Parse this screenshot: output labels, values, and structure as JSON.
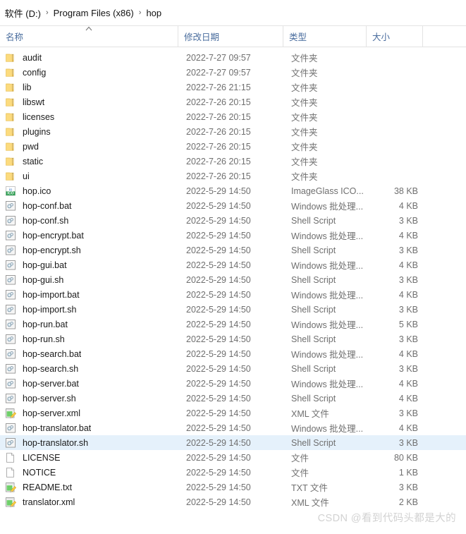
{
  "breadcrumb": {
    "lead_separator": "›",
    "separator": "›",
    "items": [
      {
        "label": "软件 (D:)"
      },
      {
        "label": "Program Files (x86)"
      },
      {
        "label": "hop"
      }
    ]
  },
  "columns": {
    "name": "名称",
    "date_modified": "修改日期",
    "type": "类型",
    "size": "大小",
    "sort_column": "名称",
    "sort_direction": "ascending",
    "sort_icon": "caret-up-icon"
  },
  "colors": {
    "selection": "#e5f1fb",
    "header_text": "#4a6d9e",
    "secondary_text": "#6f6f6f",
    "folder_icon": "#fcdb7e",
    "watermark": "#d2d2d2"
  },
  "files": [
    {
      "name": "audit",
      "date": "2022-7-27 09:57",
      "type": "文件夹",
      "size": "",
      "icon": "folder-icon",
      "selected": false
    },
    {
      "name": "config",
      "date": "2022-7-27 09:57",
      "type": "文件夹",
      "size": "",
      "icon": "folder-icon",
      "selected": false
    },
    {
      "name": "lib",
      "date": "2022-7-26 21:15",
      "type": "文件夹",
      "size": "",
      "icon": "folder-icon",
      "selected": false
    },
    {
      "name": "libswt",
      "date": "2022-7-26 20:15",
      "type": "文件夹",
      "size": "",
      "icon": "folder-icon",
      "selected": false
    },
    {
      "name": "licenses",
      "date": "2022-7-26 20:15",
      "type": "文件夹",
      "size": "",
      "icon": "folder-icon",
      "selected": false
    },
    {
      "name": "plugins",
      "date": "2022-7-26 20:15",
      "type": "文件夹",
      "size": "",
      "icon": "folder-icon",
      "selected": false
    },
    {
      "name": "pwd",
      "date": "2022-7-26 20:15",
      "type": "文件夹",
      "size": "",
      "icon": "folder-icon",
      "selected": false
    },
    {
      "name": "static",
      "date": "2022-7-26 20:15",
      "type": "文件夹",
      "size": "",
      "icon": "folder-icon",
      "selected": false
    },
    {
      "name": "ui",
      "date": "2022-7-26 20:15",
      "type": "文件夹",
      "size": "",
      "icon": "folder-icon",
      "selected": false
    },
    {
      "name": "hop.ico",
      "date": "2022-5-29 14:50",
      "type": "ImageGlass ICO...",
      "size": "38 KB",
      "icon": "ico-file-icon",
      "selected": false
    },
    {
      "name": "hop-conf.bat",
      "date": "2022-5-29 14:50",
      "type": "Windows 批处理...",
      "size": "4 KB",
      "icon": "script-file-icon",
      "selected": false
    },
    {
      "name": "hop-conf.sh",
      "date": "2022-5-29 14:50",
      "type": "Shell Script",
      "size": "3 KB",
      "icon": "script-file-icon",
      "selected": false
    },
    {
      "name": "hop-encrypt.bat",
      "date": "2022-5-29 14:50",
      "type": "Windows 批处理...",
      "size": "4 KB",
      "icon": "script-file-icon",
      "selected": false
    },
    {
      "name": "hop-encrypt.sh",
      "date": "2022-5-29 14:50",
      "type": "Shell Script",
      "size": "3 KB",
      "icon": "script-file-icon",
      "selected": false
    },
    {
      "name": "hop-gui.bat",
      "date": "2022-5-29 14:50",
      "type": "Windows 批处理...",
      "size": "4 KB",
      "icon": "script-file-icon",
      "selected": false
    },
    {
      "name": "hop-gui.sh",
      "date": "2022-5-29 14:50",
      "type": "Shell Script",
      "size": "3 KB",
      "icon": "script-file-icon",
      "selected": false
    },
    {
      "name": "hop-import.bat",
      "date": "2022-5-29 14:50",
      "type": "Windows 批处理...",
      "size": "4 KB",
      "icon": "script-file-icon",
      "selected": false
    },
    {
      "name": "hop-import.sh",
      "date": "2022-5-29 14:50",
      "type": "Shell Script",
      "size": "3 KB",
      "icon": "script-file-icon",
      "selected": false
    },
    {
      "name": "hop-run.bat",
      "date": "2022-5-29 14:50",
      "type": "Windows 批处理...",
      "size": "5 KB",
      "icon": "script-file-icon",
      "selected": false
    },
    {
      "name": "hop-run.sh",
      "date": "2022-5-29 14:50",
      "type": "Shell Script",
      "size": "3 KB",
      "icon": "script-file-icon",
      "selected": false
    },
    {
      "name": "hop-search.bat",
      "date": "2022-5-29 14:50",
      "type": "Windows 批处理...",
      "size": "4 KB",
      "icon": "script-file-icon",
      "selected": false
    },
    {
      "name": "hop-search.sh",
      "date": "2022-5-29 14:50",
      "type": "Shell Script",
      "size": "3 KB",
      "icon": "script-file-icon",
      "selected": false
    },
    {
      "name": "hop-server.bat",
      "date": "2022-5-29 14:50",
      "type": "Windows 批处理...",
      "size": "4 KB",
      "icon": "script-file-icon",
      "selected": false
    },
    {
      "name": "hop-server.sh",
      "date": "2022-5-29 14:50",
      "type": "Shell Script",
      "size": "4 KB",
      "icon": "script-file-icon",
      "selected": false
    },
    {
      "name": "hop-server.xml",
      "date": "2022-5-29 14:50",
      "type": "XML 文件",
      "size": "3 KB",
      "icon": "xml-file-icon",
      "selected": false
    },
    {
      "name": "hop-translator.bat",
      "date": "2022-5-29 14:50",
      "type": "Windows 批处理...",
      "size": "4 KB",
      "icon": "script-file-icon",
      "selected": false
    },
    {
      "name": "hop-translator.sh",
      "date": "2022-5-29 14:50",
      "type": "Shell Script",
      "size": "3 KB",
      "icon": "script-file-icon",
      "selected": true
    },
    {
      "name": "LICENSE",
      "date": "2022-5-29 14:50",
      "type": "文件",
      "size": "80 KB",
      "icon": "blank-file-icon",
      "selected": false
    },
    {
      "name": "NOTICE",
      "date": "2022-5-29 14:50",
      "type": "文件",
      "size": "1 KB",
      "icon": "blank-file-icon",
      "selected": false
    },
    {
      "name": "README.txt",
      "date": "2022-5-29 14:50",
      "type": "TXT 文件",
      "size": "3 KB",
      "icon": "xml-file-icon",
      "selected": false
    },
    {
      "name": "translator.xml",
      "date": "2022-5-29 14:50",
      "type": "XML 文件",
      "size": "2 KB",
      "icon": "xml-file-icon",
      "selected": false
    }
  ],
  "watermark": "CSDN @看到代码头都是大的"
}
